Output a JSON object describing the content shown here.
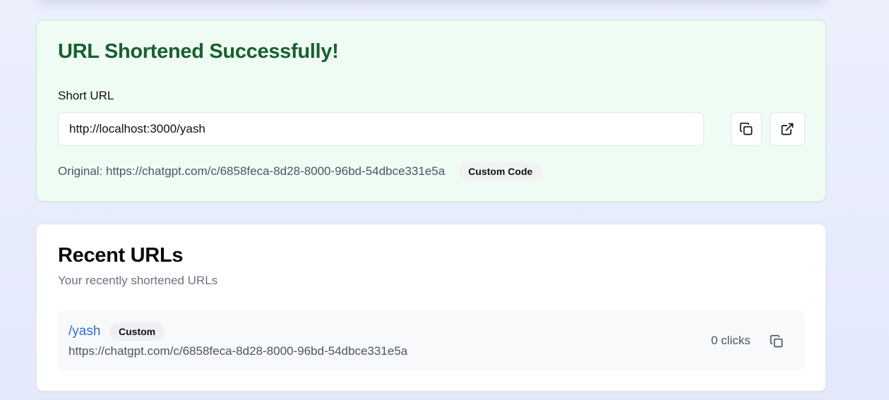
{
  "success": {
    "title": "URL Shortened Successfully!",
    "short_url_label": "Short URL",
    "short_url_value": "http://localhost:3000/yash",
    "copy_icon": "copy-icon",
    "open_icon": "external-link-icon",
    "original_prefix": "Original: ",
    "original_url": "https://chatgpt.com/c/6858feca-8d28-8000-96bd-54dbce331e5a",
    "badge": "Custom Code"
  },
  "recent": {
    "title": "Recent URLs",
    "subtitle": "Your recently shortened URLs",
    "items": [
      {
        "code": "/yash",
        "badge": "Custom",
        "original": "https://chatgpt.com/c/6858feca-8d28-8000-96bd-54dbce331e5a",
        "clicks": "0 clicks",
        "copy_icon": "copy-icon"
      }
    ]
  },
  "colors": {
    "success_title": "#17602e",
    "success_bg": "#effcf3",
    "link": "#2f6fd6"
  }
}
